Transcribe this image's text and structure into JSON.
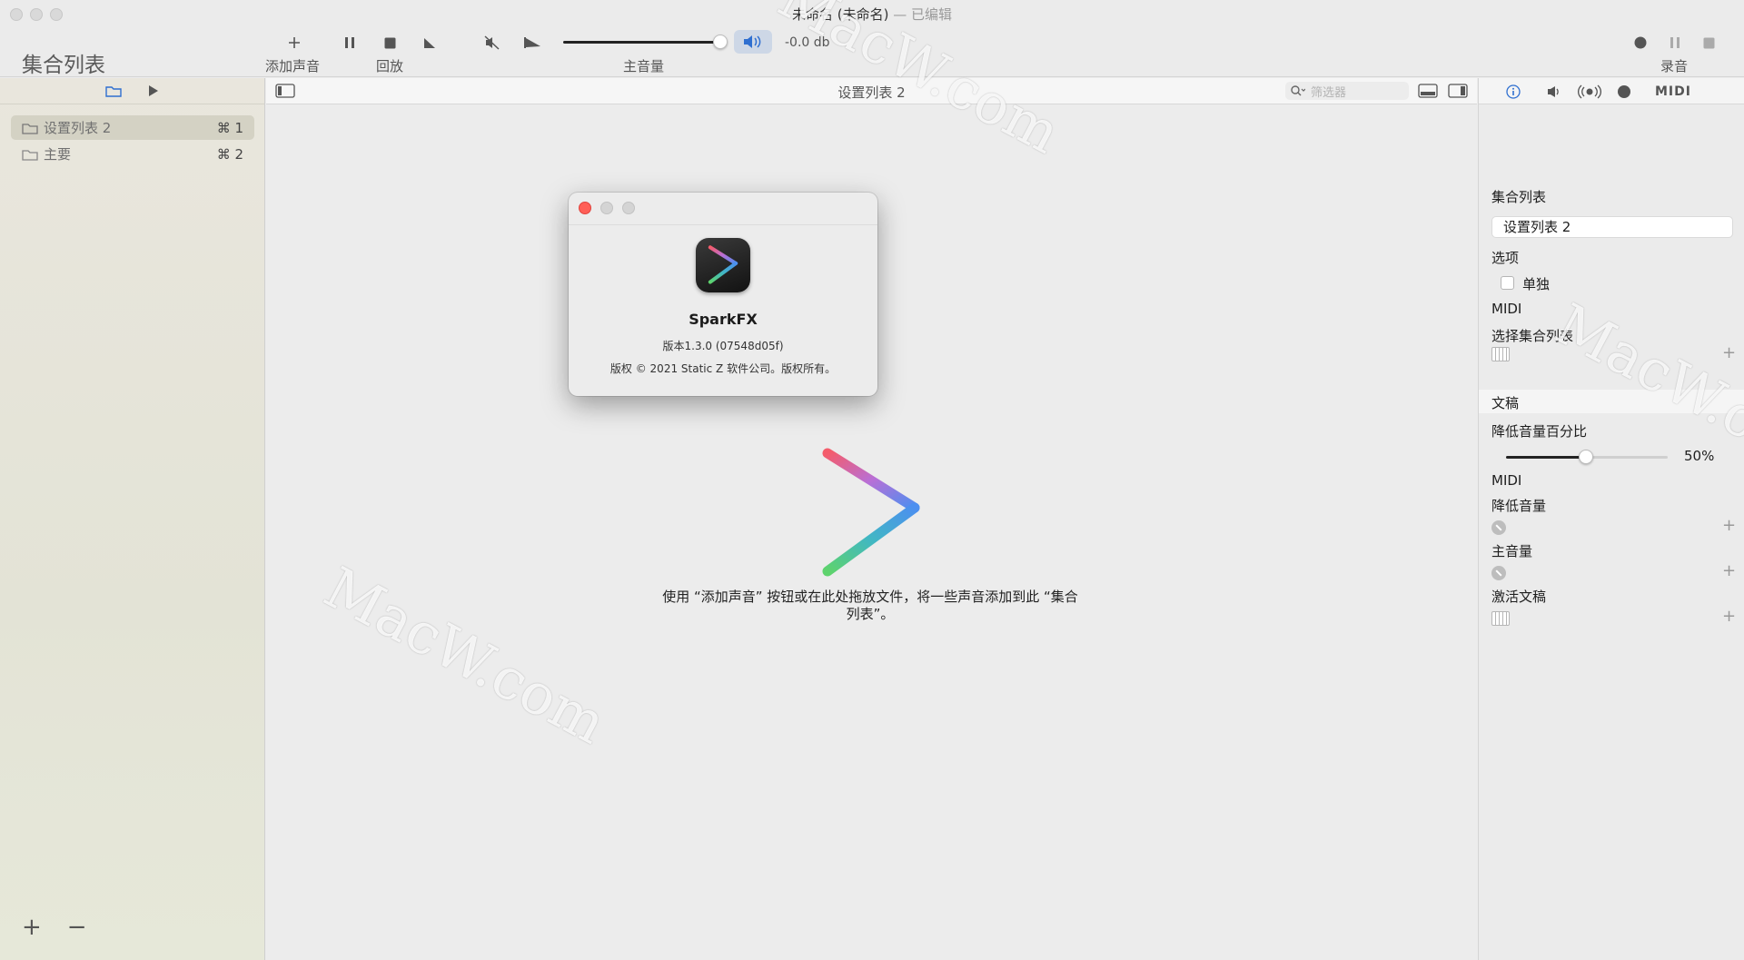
{
  "window": {
    "title": "未命名 (未命名)",
    "edited": "— 已编辑"
  },
  "toolbar": {
    "sidebar_title": "集合列表",
    "add_sound_label": "添加声音",
    "playback_label": "回放",
    "master_volume_label": "主音量",
    "volume_db": "-0.0 db",
    "record_label": "录音",
    "master_volume_level": 0.97
  },
  "sidebar": {
    "items": [
      {
        "name": "设置列表 2",
        "shortcut": "⌘ 1",
        "selected": true
      },
      {
        "name": "主要",
        "shortcut": "⌘ 2",
        "selected": false
      }
    ],
    "add": "+",
    "remove": "−"
  },
  "main": {
    "header_title": "设置列表 2",
    "filter_placeholder": "筛选器",
    "hint": "使用 “添加声音” 按钮或在此处拖放文件，将一些声音添加到此 “集合列表”。"
  },
  "about": {
    "app_name": "SparkFX",
    "version": "版本1.3.0 (07548d05f)",
    "copyright": "版权 © 2021 Static Z 软件公司。版权所有。"
  },
  "inspector": {
    "tabs": [
      "info-icon",
      "speaker-icon",
      "broadcast-icon",
      "record-dot-icon",
      "midi-icon"
    ],
    "midi_tab_label": "MIDI",
    "setlist_heading": "集合列表",
    "setlist_name": "设置列表 2",
    "options_heading": "选项",
    "solo_label": "单独",
    "midi_heading": "MIDI",
    "select_setlist": "选择集合列表",
    "document_heading": "文稿",
    "duck_percent_label": "降低音量百分比",
    "duck_percent_value": "50%",
    "duck_percent_level": 0.5,
    "midi_heading_2": "MIDI",
    "duck_volume": "降低音量",
    "master_volume": "主音量",
    "activate_document": "激活文稿"
  },
  "watermark": "MacW.com",
  "colors": {
    "close_red": "#ff5f57",
    "accent_blue": "#2f6fd0",
    "selection": "#d4d2c4"
  }
}
